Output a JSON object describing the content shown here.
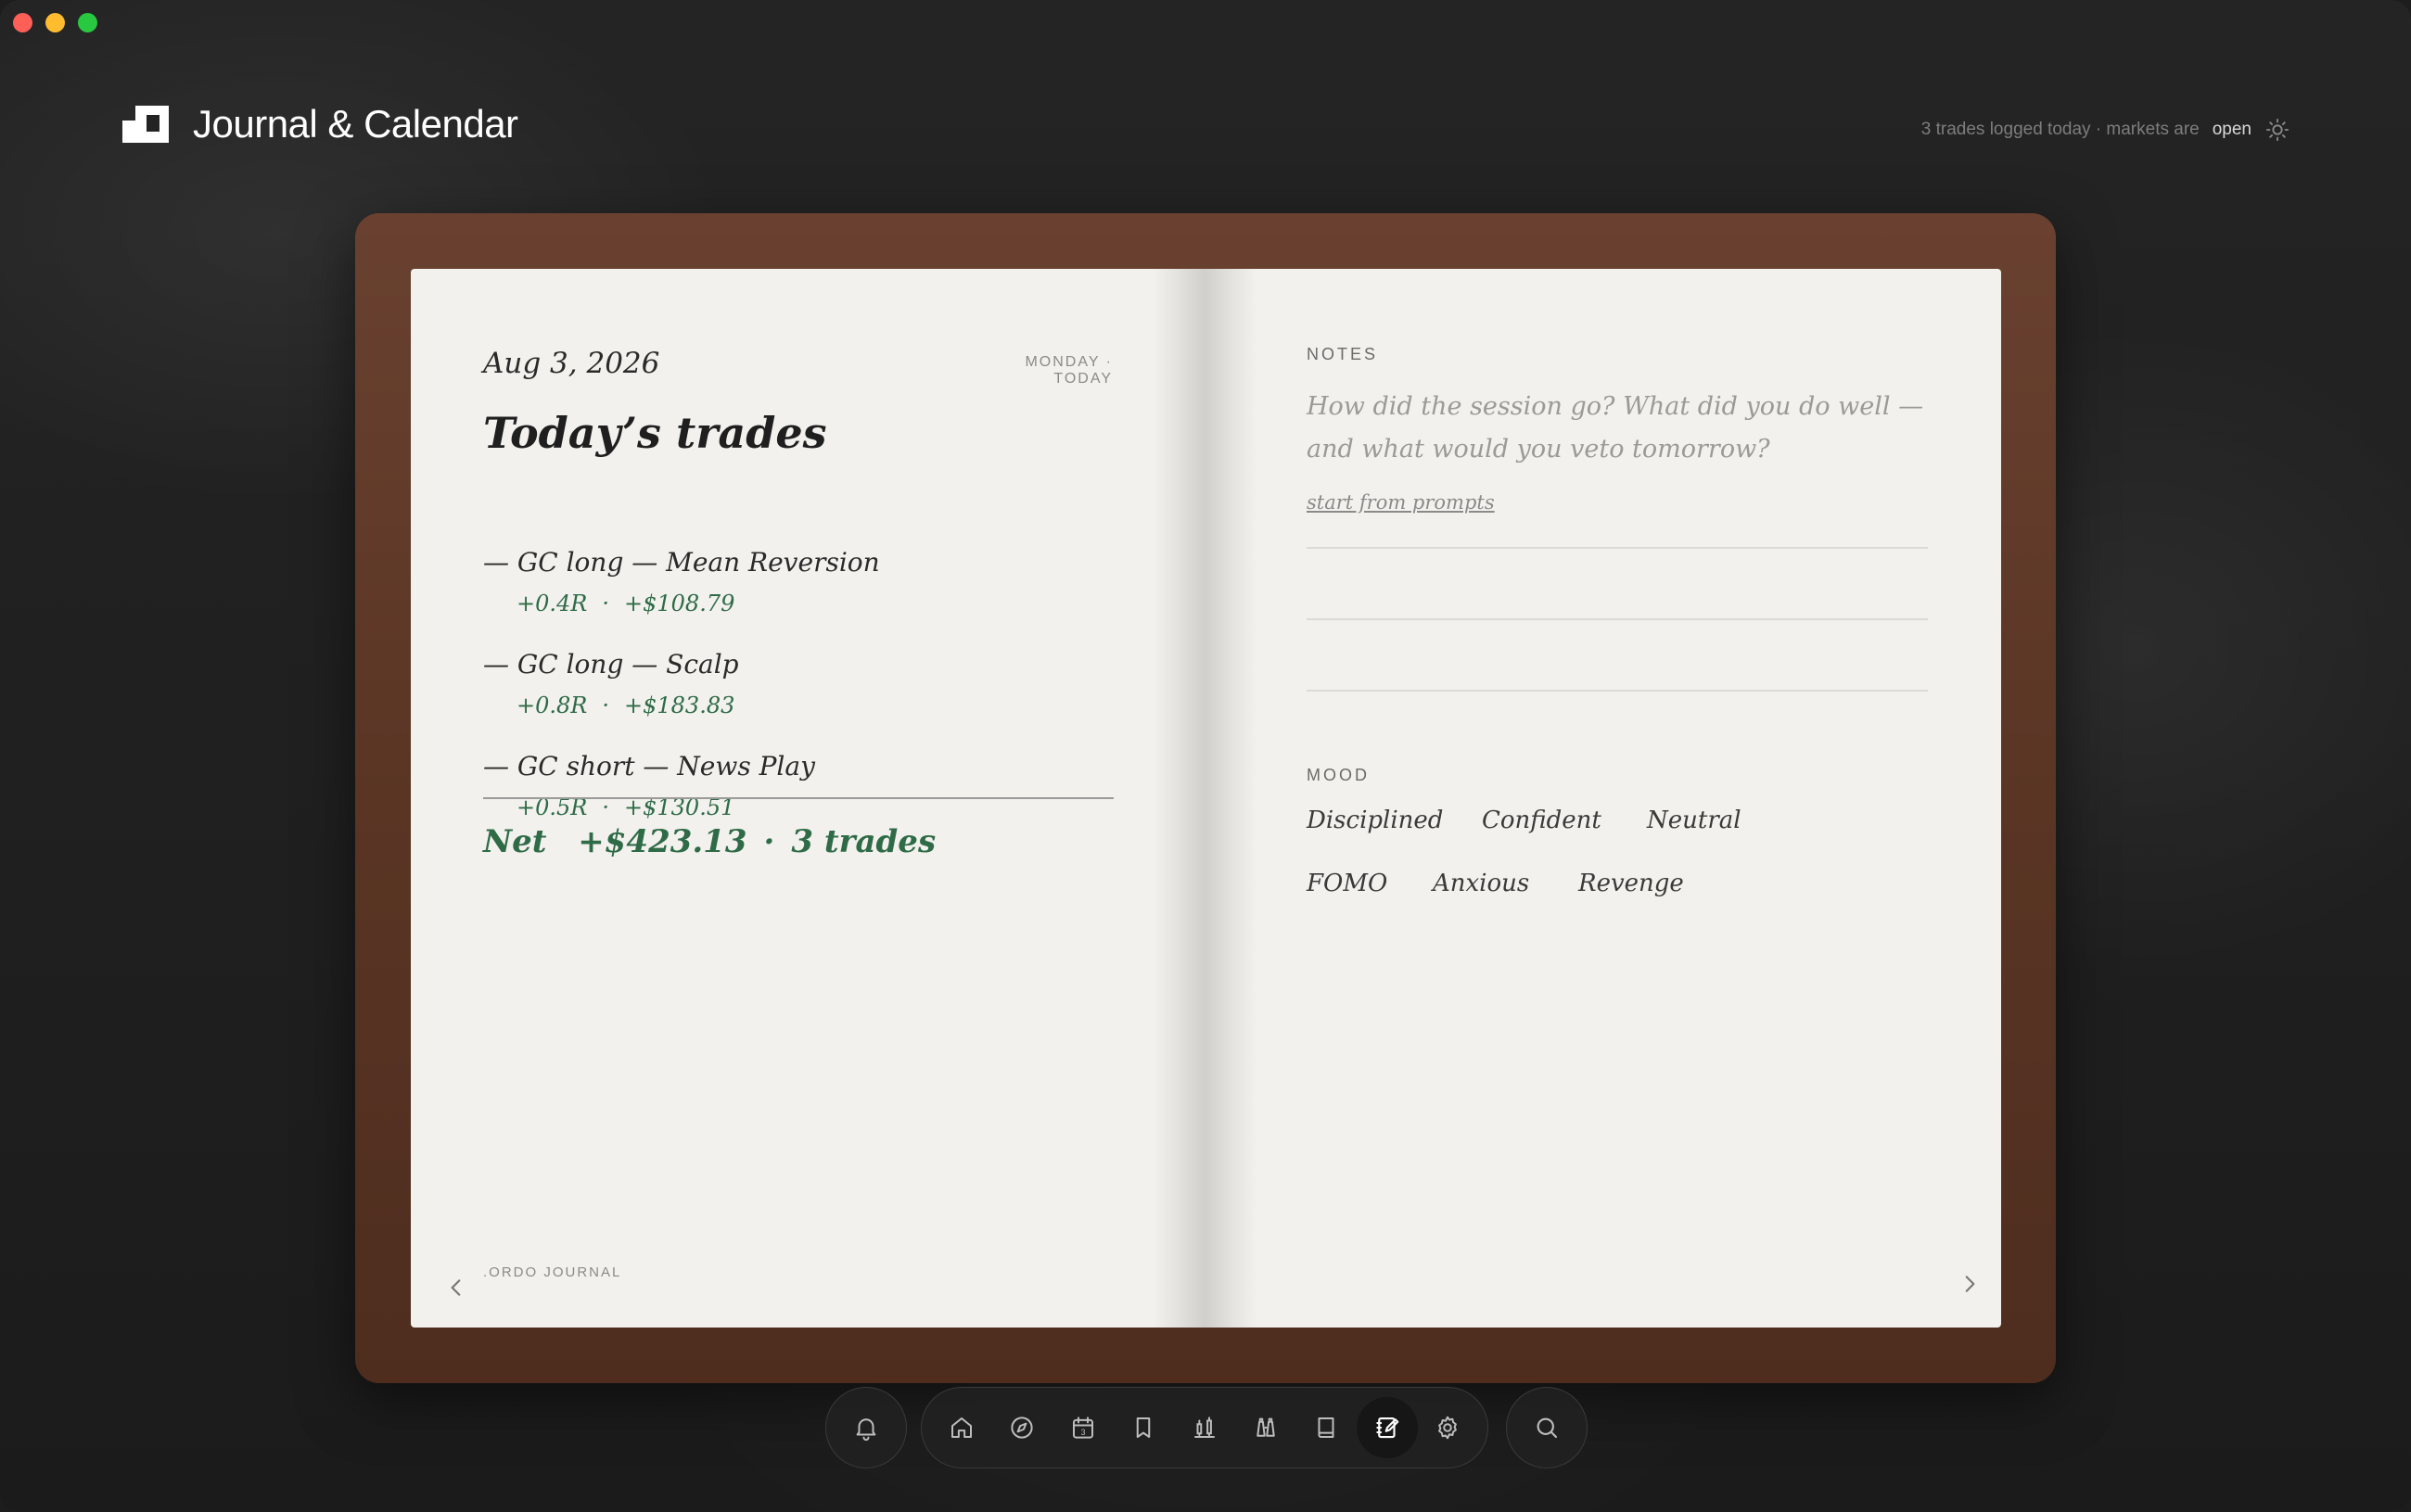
{
  "app": {
    "title": "Journal & Calendar",
    "status_text": "3 trades logged today · markets are",
    "market_state": "open"
  },
  "journal": {
    "date": "Aug 3, 2026",
    "day_label": "MONDAY · TODAY",
    "heading": "Today’s trades",
    "trades": [
      {
        "title": "— GC long — Mean Reversion",
        "r": "+0.4R",
        "pnl": "+$108.79"
      },
      {
        "title": "— GC long — Scalp",
        "r": "+0.8R",
        "pnl": "+$183.83"
      },
      {
        "title": "— GC short — News Play",
        "r": "+0.5R",
        "pnl": "+$130.51"
      }
    ],
    "separator": "·",
    "net_label": "Net",
    "net_value": "+$423.13",
    "net_count": "3 trades",
    "footer": ".ORDO JOURNAL"
  },
  "notes": {
    "label": "NOTES",
    "placeholder": "How did the session go? What did you do well — and what would you veto tomorrow?",
    "prompts_link": "start from prompts"
  },
  "mood": {
    "label": "MOOD",
    "options": [
      "Disciplined",
      "Confident",
      "Neutral",
      "FOMO",
      "Anxious",
      "Revenge"
    ]
  },
  "dock": {
    "left": [
      "bell-icon"
    ],
    "main": [
      "home-icon",
      "compass-icon",
      "calendar-icon",
      "bookmark-icon",
      "chart-icon",
      "binoculars-icon",
      "book-icon",
      "journal-icon",
      "gear-icon"
    ],
    "right": [
      "search-icon"
    ],
    "calendar_day": "3",
    "active": "journal-icon"
  },
  "colors": {
    "accent_green": "#2f6b47",
    "leather": "#5a3524",
    "paper": "#f2f1ed"
  }
}
